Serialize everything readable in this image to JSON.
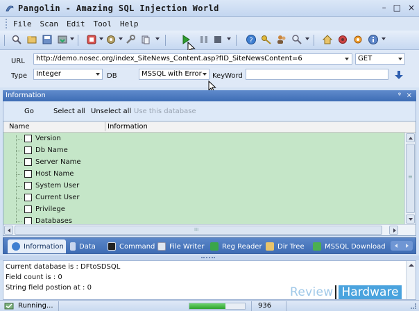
{
  "window": {
    "title": "Pangolin - Amazing SQL Injection World",
    "controls": {
      "minimize": "–",
      "maximize": "□",
      "close": "×"
    }
  },
  "menu": [
    "File",
    "Scan",
    "Edit",
    "Tool",
    "Help"
  ],
  "form": {
    "url_label": "URL",
    "url_value": "http://demo.nosec.org/index_SiteNews_Content.asp?fID_SiteNewsContent=6",
    "method_value": "GET",
    "type_label": "Type",
    "type_value": "Integer",
    "db_label": "DB",
    "db_value": "MSSQL with Error",
    "keyword_label": "KeyWord",
    "keyword_value": ""
  },
  "panel": {
    "title": "Information",
    "pin": "ᵠ",
    "close": "×",
    "actions": {
      "go": "Go",
      "select_all": "Select all",
      "unselect_all": "Unselect all",
      "use_db": "Use this database"
    },
    "columns": {
      "name": "Name",
      "information": "Information"
    },
    "items": [
      "Version",
      "Db Name",
      "Server Name",
      "Host Name",
      "System User",
      "Current User",
      "Privilege",
      "Databases"
    ],
    "vscroll_grip": "≡",
    "hscroll_grip": "III"
  },
  "tabs": [
    "Information",
    "Data",
    "Command",
    "File Writer",
    "Reg Reader",
    "Dir Tree",
    "MSSQL Download"
  ],
  "console": [
    "Current database is : DFtoSDSQL",
    "Field count is : 0",
    "String field postion at : 0"
  ],
  "watermark": {
    "left": "Review",
    "right": "Hardware"
  },
  "status": {
    "text": "Running...",
    "progress": 0.65,
    "count": "936"
  },
  "colors": {
    "accent": "#3e6cb4",
    "list_bg": "#c5e6c8",
    "highlight": "#f5ec00",
    "progress": "#2ea32e"
  },
  "icons": {
    "toolbar": [
      "search-icon",
      "open-icon",
      "save-icon",
      "import-icon",
      "settings-icon",
      "plugin-icon",
      "tool-icon",
      "copy-icon",
      "play-icon",
      "pause-icon",
      "stop-icon",
      "help-icon",
      "key-icon",
      "users-icon",
      "magnifier-icon",
      "home-icon",
      "bug-icon",
      "gear-icon",
      "info-icon"
    ]
  }
}
